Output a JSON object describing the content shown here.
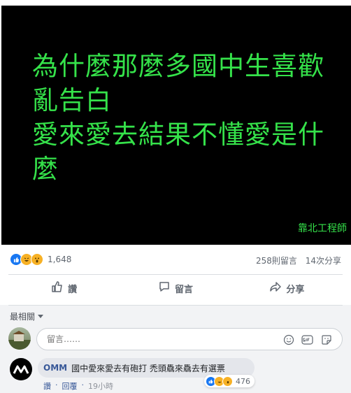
{
  "post": {
    "lines": [
      "為什麼那麼多國中生喜歡",
      "亂告白",
      "愛來愛去結果不懂愛是什",
      "麼"
    ],
    "watermark": "靠北工程師",
    "text_color": "#35e24a",
    "background": "#000000"
  },
  "summary": {
    "reaction_icons": [
      "like-icon",
      "haha-icon",
      "wow-icon"
    ],
    "reaction_count": "1,648",
    "comments": "258則留言",
    "shares": "14次分享"
  },
  "actions": {
    "like": "讚",
    "comment": "留言",
    "share": "分享"
  },
  "sort_label": "最相關",
  "comment_box": {
    "placeholder": "留言……",
    "icons": [
      "emoji-icon",
      "gif-icon",
      "sticker-icon"
    ]
  },
  "comment": {
    "author": "OMM",
    "text": "國中愛來愛去有砲打 禿頭驫來驫去有選票",
    "reaction_count": "476",
    "like_label": "讚",
    "reply_label": "回覆",
    "time": "19小時"
  },
  "colors": {
    "accent": "#1877f2",
    "link": "#385898"
  }
}
